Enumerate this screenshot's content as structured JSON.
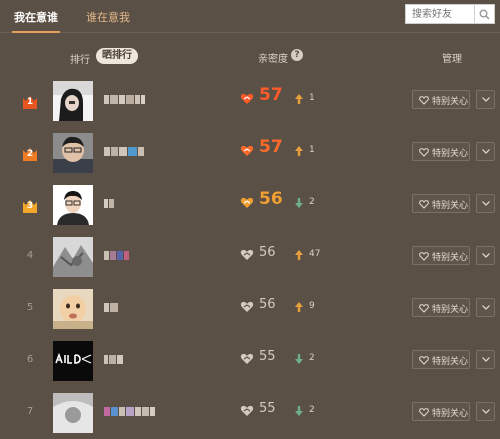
{
  "tabs": [
    {
      "label": "我在意谁",
      "active": true
    },
    {
      "label": "谁在意我",
      "active": false
    }
  ],
  "search": {
    "placeholder": "搜索好友"
  },
  "header": {
    "rank_label": "排行",
    "share_rank_label": "晒排行",
    "intimacy_label": "亲密度",
    "help_label": "?",
    "manage_label": "管理"
  },
  "colors": {
    "background": "#5b5045",
    "accent": "#e6a15d",
    "top_score": "#ff5a2a",
    "third_score": "#f0a030",
    "up_arrow": "#e8a03a",
    "down_arrow": "#6fb08a"
  },
  "rows": [
    {
      "rank": "1",
      "score": "57",
      "trend": "up",
      "delta": "1",
      "follow_label": "特别关心"
    },
    {
      "rank": "2",
      "score": "57",
      "trend": "up",
      "delta": "1",
      "follow_label": "特别关心"
    },
    {
      "rank": "3",
      "score": "56",
      "trend": "down",
      "delta": "2",
      "follow_label": "特别关心"
    },
    {
      "rank": "4",
      "score": "56",
      "trend": "up",
      "delta": "47",
      "follow_label": "特别关心"
    },
    {
      "rank": "5",
      "score": "56",
      "trend": "up",
      "delta": "9",
      "follow_label": "特别关心"
    },
    {
      "rank": "6",
      "score": "55",
      "trend": "down",
      "delta": "2",
      "follow_label": "特别关心"
    },
    {
      "rank": "7",
      "score": "55",
      "trend": "down",
      "delta": "2",
      "follow_label": "特别关心"
    }
  ]
}
